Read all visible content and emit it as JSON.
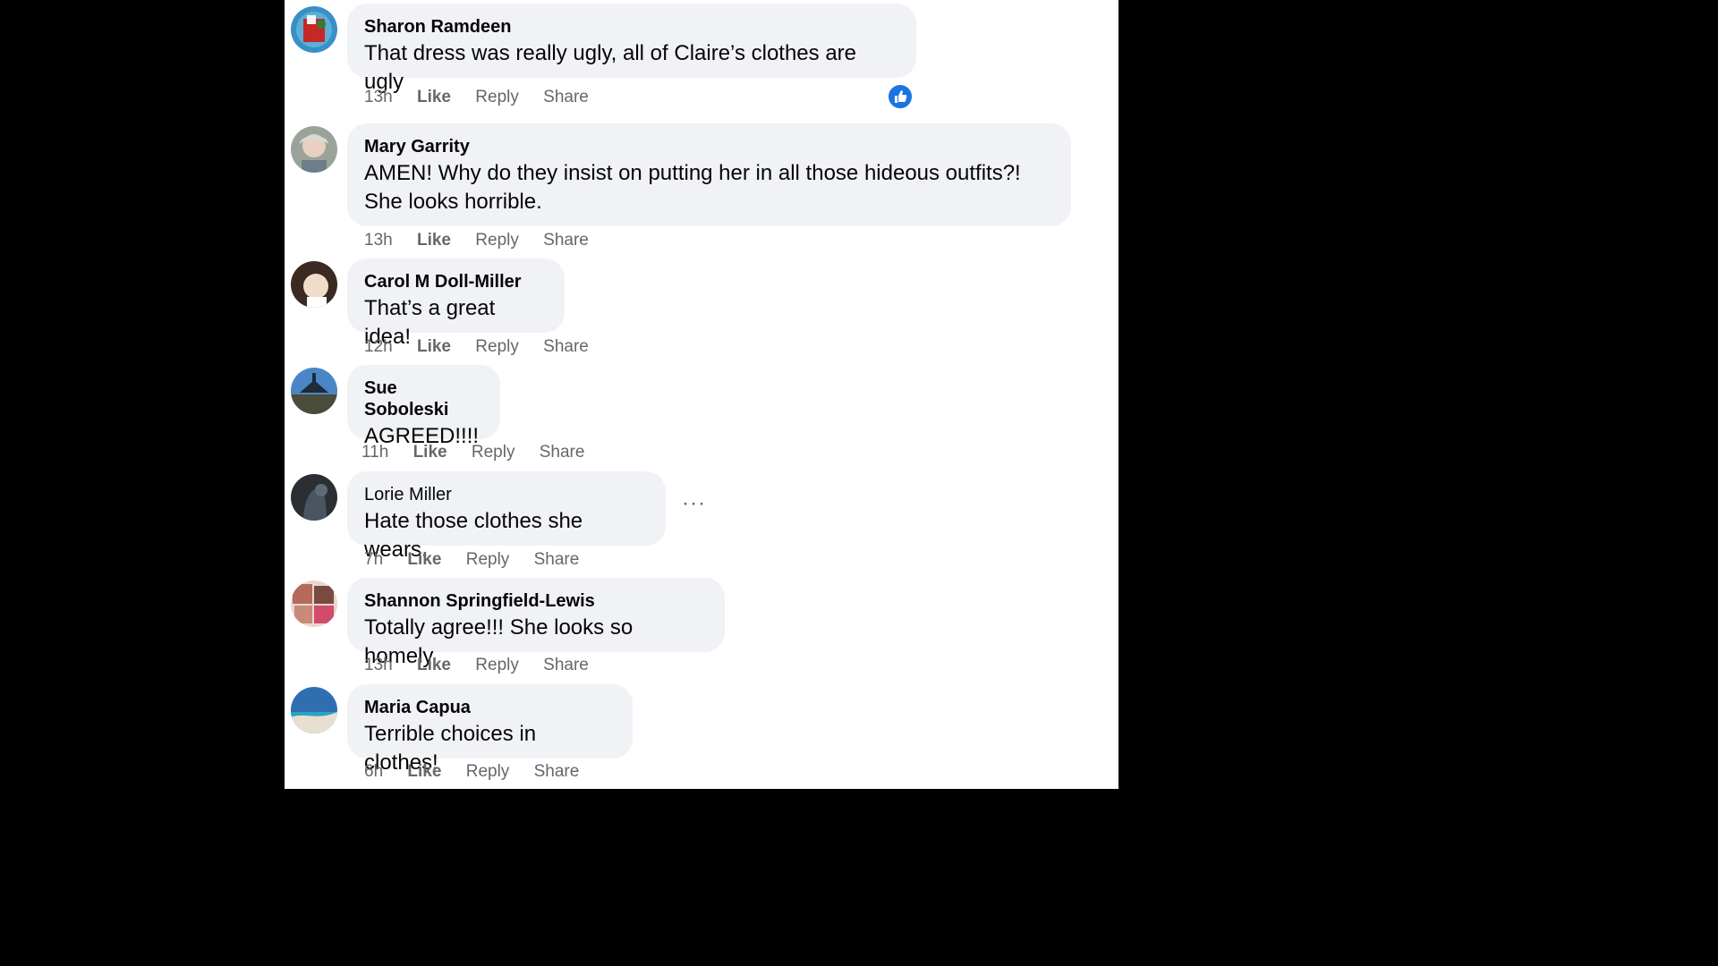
{
  "comments": [
    {
      "name": "Sharon Ramdeen",
      "text": "That dress was really ugly, all of Claire’s clothes are ugly",
      "time": "13h",
      "like": "Like",
      "reply": "Reply",
      "share": "Share"
    },
    {
      "name": "Mary Garrity",
      "text": "AMEN! Why do they insist on putting her in all those hideous outfits?! She looks horrible.",
      "time": "13h",
      "like": "Like",
      "reply": "Reply",
      "share": "Share"
    },
    {
      "name": "Carol M Doll-Miller",
      "text": "That’s a great idea!",
      "time": "12h",
      "like": "Like",
      "reply": "Reply",
      "share": "Share"
    },
    {
      "name": "Sue Soboleski",
      "text": "AGREED!!!!",
      "time": "11h",
      "like": "Like",
      "reply": "Reply",
      "share": "Share"
    },
    {
      "name": "Lorie Miller",
      "text": "Hate those clothes she wears.",
      "time": "7h",
      "like": "Like",
      "reply": "Reply",
      "share": "Share"
    },
    {
      "name": "Shannon Springfield-Lewis",
      "text": "Totally agree!!! She looks so homely",
      "time": "13h",
      "like": "Like",
      "reply": "Reply",
      "share": "Share"
    },
    {
      "name": "Maria Capua",
      "text": "Terrible choices in clothes!",
      "time": "6h",
      "like": "Like",
      "reply": "Reply",
      "share": "Share"
    }
  ],
  "more_options_icon": "ellipsis-icon",
  "reaction_icon": "thumbs-up-icon",
  "colors": {
    "bubble": "#f0f2f5",
    "meta": "#65676b",
    "like_blue": "#1b74e4"
  }
}
